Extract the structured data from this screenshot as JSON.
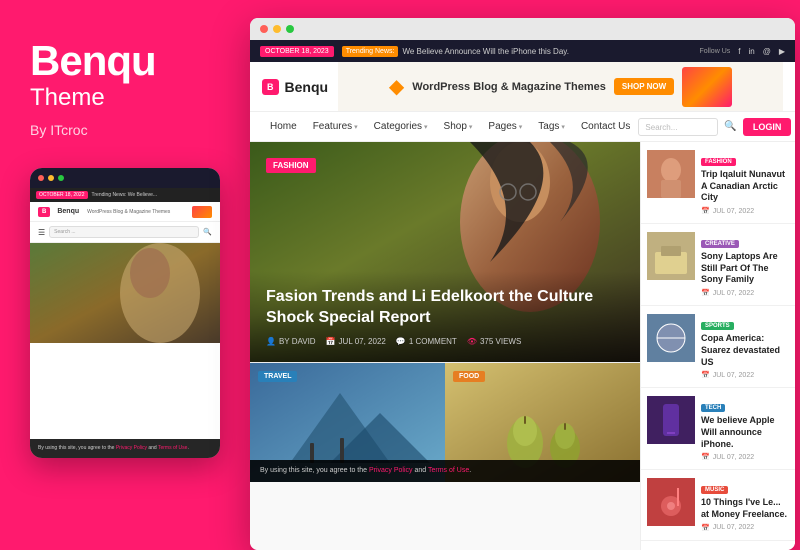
{
  "brand": {
    "name": "Benqu",
    "subtitle": "Theme",
    "by": "By ITcroc"
  },
  "mobile_mockup": {
    "date_badge": "OCTOBER 18, 2022",
    "logo": "B Benqu",
    "banner_text": "WordPress Blog & Magazine Themes",
    "search_placeholder": "Search ...",
    "hero_person_alt": "fashion person",
    "cookie_text": "By using this site, you agree to the ",
    "cookie_link1": "Privacy Policy",
    "cookie_and": " and ",
    "cookie_link2": "Terms of Use",
    "cookie_period": "."
  },
  "browser": {
    "news_date": "OCTOBER 18, 2023",
    "trending_label": "Trending News:",
    "trending_text": "We Believe Announce Will the iPhone this Day.",
    "follow_us": "Follow Us",
    "social": [
      "f",
      "in",
      "@",
      "▶"
    ],
    "logo_badge": "B",
    "logo_name": "Benqu",
    "banner_text": "WordPress Blog & Magazine Themes",
    "banner_btn": "SHOP NOW"
  },
  "nav": {
    "items": [
      {
        "label": "Home",
        "has_arrow": false
      },
      {
        "label": "Features",
        "has_arrow": true
      },
      {
        "label": "Categories",
        "has_arrow": true
      },
      {
        "label": "Shop",
        "has_arrow": true
      },
      {
        "label": "Pages",
        "has_arrow": true
      },
      {
        "label": "Tags",
        "has_arrow": true
      },
      {
        "label": "Contact Us",
        "has_arrow": false
      }
    ],
    "search_placeholder": "Search...",
    "login_label": "LOGIN"
  },
  "hero_post": {
    "category": "FASHION",
    "title": "Fasion Trends and Li Edelkoort the Culture Shock Special Report",
    "author_label": "BY DAVID",
    "date_label": "JUL 07, 2022",
    "comments_label": "1 COMMENT",
    "views_label": "375 VIEWS"
  },
  "bottom_posts": [
    {
      "category": "TRAVEL",
      "badge_class": "badge-travel",
      "img_class": "bottom-post-travel"
    },
    {
      "category": "FOOD",
      "badge_class": "badge-food",
      "img_class": "bottom-post-food"
    }
  ],
  "cookie_bar": {
    "text": "By using this site, you agree to the ",
    "link1": "Privacy Policy",
    "and": " and ",
    "link2": "Terms of Use",
    "period": "."
  },
  "sidebar_posts": [
    {
      "id": 1,
      "category": "FASHION",
      "cat_class": "cat-fashion",
      "img_class": "sidebar-post-img-fashion",
      "title": "Trip Iqaluit Nunavut A Canadian Arctic City",
      "date": "JUL 07, 2022"
    },
    {
      "id": 2,
      "category": "CREATIVE",
      "cat_class": "cat-creative",
      "img_class": "sidebar-post-img-creative",
      "title": "Sony Laptops Are Still Part Of The Sony Family",
      "date": "JUL 07, 2022"
    },
    {
      "id": 3,
      "category": "SPORTS",
      "cat_class": "cat-sports",
      "img_class": "sidebar-post-img-sports",
      "title": "Copa America: Suarez devastated US",
      "date": "JUL 07, 2022"
    },
    {
      "id": 4,
      "category": "TECH",
      "cat_class": "cat-tech",
      "img_class": "sidebar-post-img-tech",
      "title": "We believe Apple Will announce iPhone.",
      "date": "JUL 07, 2022"
    },
    {
      "id": 5,
      "category": "MUSIC",
      "cat_class": "cat-music",
      "img_class": "sidebar-post-img-music",
      "title": "10 Things I've Le... at Money Freelance.",
      "date": "JUL 07, 2022"
    }
  ]
}
